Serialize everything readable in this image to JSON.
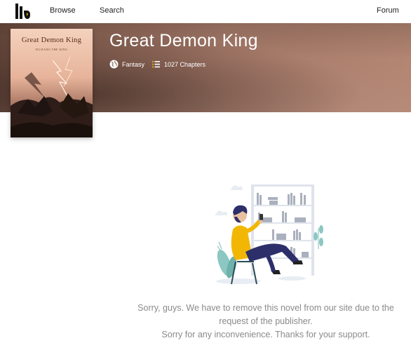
{
  "nav": {
    "logo_icon": "webnovel-logo-icon",
    "browse_label": "Browse",
    "search_label": "Search",
    "forum_label": "Forum"
  },
  "book": {
    "title": "Great Demon King",
    "genre": "Fantasy",
    "genre_icon": "globe-icon",
    "chapters": "1027 Chapters",
    "chapters_icon": "list-icon",
    "cover": {
      "title": "Great Demon King",
      "subtitle": "WUJIANG THE KING"
    }
  },
  "notice": {
    "line1": "Sorry, guys. We have to remove this novel from our site due to the request of the publisher.",
    "line2": "Sorry for any inconvenience. Thanks for your support.",
    "illustration": "reading-person-illustration"
  },
  "colors": {
    "accent": "#f2b705",
    "figure_shirt": "#f2b705",
    "figure_pants": "#2d2f6b",
    "plant": "#8cc7c2",
    "text_muted": "#8a8a8a"
  }
}
